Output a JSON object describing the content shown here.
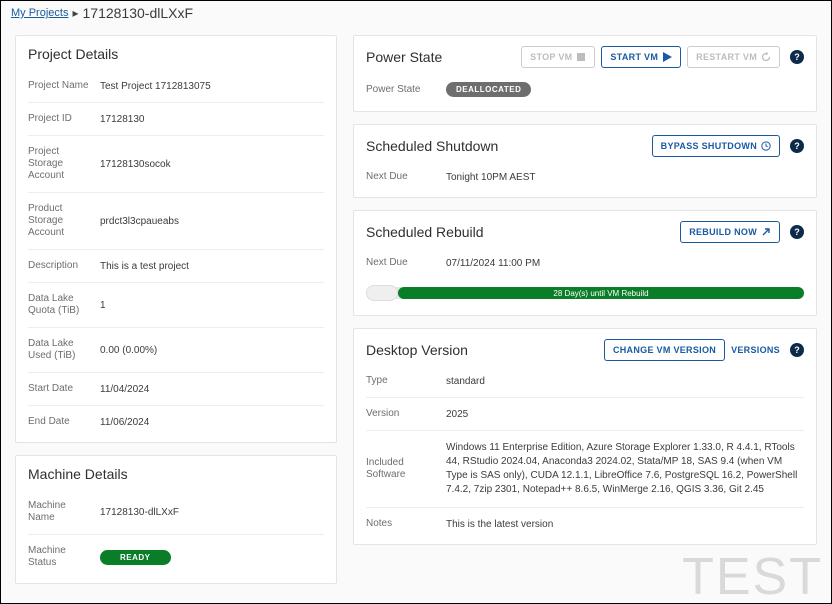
{
  "breadcrumb": {
    "root": "My Projects",
    "current": "17128130-dlLXxF"
  },
  "project_details": {
    "title": "Project Details",
    "rows": [
      {
        "k": "Project Name",
        "v": "Test Project 1712813075"
      },
      {
        "k": "Project ID",
        "v": "17128130"
      },
      {
        "k": "Project Storage Account",
        "v": "17128130socok"
      },
      {
        "k": "Product Storage Account",
        "v": "prdct3l3cpaueabs"
      },
      {
        "k": "Description",
        "v": "This is a test project"
      },
      {
        "k": "Data Lake Quota (TiB)",
        "v": "1"
      },
      {
        "k": "Data Lake Used (TiB)",
        "v": "0.00 (0.00%)"
      },
      {
        "k": "Start Date",
        "v": "11/04/2024"
      },
      {
        "k": "End Date",
        "v": "11/06/2024"
      }
    ]
  },
  "machine_details": {
    "title": "Machine Details",
    "name_label": "Machine Name",
    "name_value": "17128130-dlLXxF",
    "status_label": "Machine Status",
    "status_value": "READY"
  },
  "power_state": {
    "title": "Power State",
    "stop": "STOP VM",
    "start": "START VM",
    "restart": "RESTART VM",
    "label": "Power State",
    "value": "DEALLOCATED"
  },
  "scheduled_shutdown": {
    "title": "Scheduled Shutdown",
    "bypass": "BYPASS SHUTDOWN",
    "next_due_label": "Next Due",
    "next_due_value": "Tonight 10PM AEST"
  },
  "scheduled_rebuild": {
    "title": "Scheduled Rebuild",
    "rebuild_now": "REBUILD NOW",
    "next_due_label": "Next Due",
    "next_due_value": "07/11/2024 11:00 PM",
    "progress_text": "28 Day(s) until VM Rebuild"
  },
  "desktop_version": {
    "title": "Desktop Version",
    "change": "CHANGE VM VERSION",
    "versions": "VERSIONS",
    "rows": [
      {
        "k": "Type",
        "v": "standard"
      },
      {
        "k": "Version",
        "v": "2025"
      },
      {
        "k": "Included Software",
        "v": "Windows 11 Enterprise Edition, Azure Storage Explorer 1.33.0, R 4.4.1, RTools 44, RStudio 2024.04, Anaconda3 2024.02, Stata/MP 18, SAS 9.4 (when VM Type is SAS only), CUDA 12.1.1, LibreOffice 7.6, PostgreSQL 16.2, PowerShell 7.4.2, 7zip 2301, Notepad++ 8.6.5, WinMerge 2.16, QGIS 3.36, Git 2.45"
      },
      {
        "k": "Notes",
        "v": "This is the latest version"
      }
    ]
  },
  "watermark": "TEST"
}
